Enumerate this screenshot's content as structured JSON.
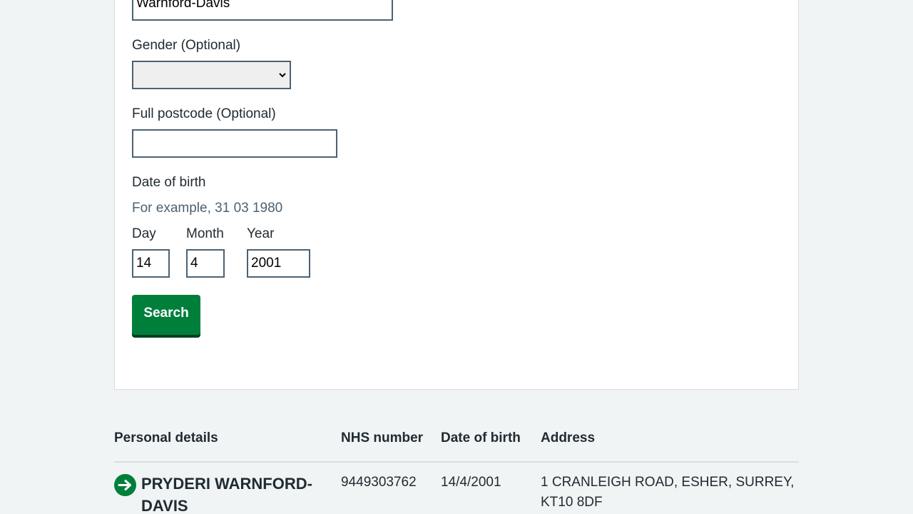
{
  "form": {
    "surname_value": "Warnford-Davis",
    "gender_label": "Gender (Optional)",
    "gender_value": "",
    "postcode_label": "Full postcode (Optional)",
    "postcode_value": "",
    "dob_label": "Date of birth",
    "dob_hint": "For example, 31 03 1980",
    "day_label": "Day",
    "day_value": "14",
    "month_label": "Month",
    "month_value": "4",
    "year_label": "Year",
    "year_value": "2001",
    "search_label": "Search"
  },
  "results": {
    "columns": [
      "Personal details",
      "NHS number",
      "Date of birth",
      "Address"
    ],
    "rows": [
      {
        "name_line1": "PRYDERI WARNFORD-",
        "name_line2": "DAVIS",
        "nhs_number": "9449303762",
        "dob": "14/4/2001",
        "address_line1": "1 CRANLEIGH ROAD, ESHER, SURREY,",
        "address_line2": "KT10 8DF"
      }
    ]
  },
  "colors": {
    "button_green": "#007f3b",
    "page_bg": "#f0f4f5",
    "text": "#212b32",
    "hint": "#4c6272",
    "border": "#4c6272"
  },
  "icons": {
    "result_arrow": "arrow-right-circle-icon",
    "select_chevron": "chevron-down-icon"
  }
}
